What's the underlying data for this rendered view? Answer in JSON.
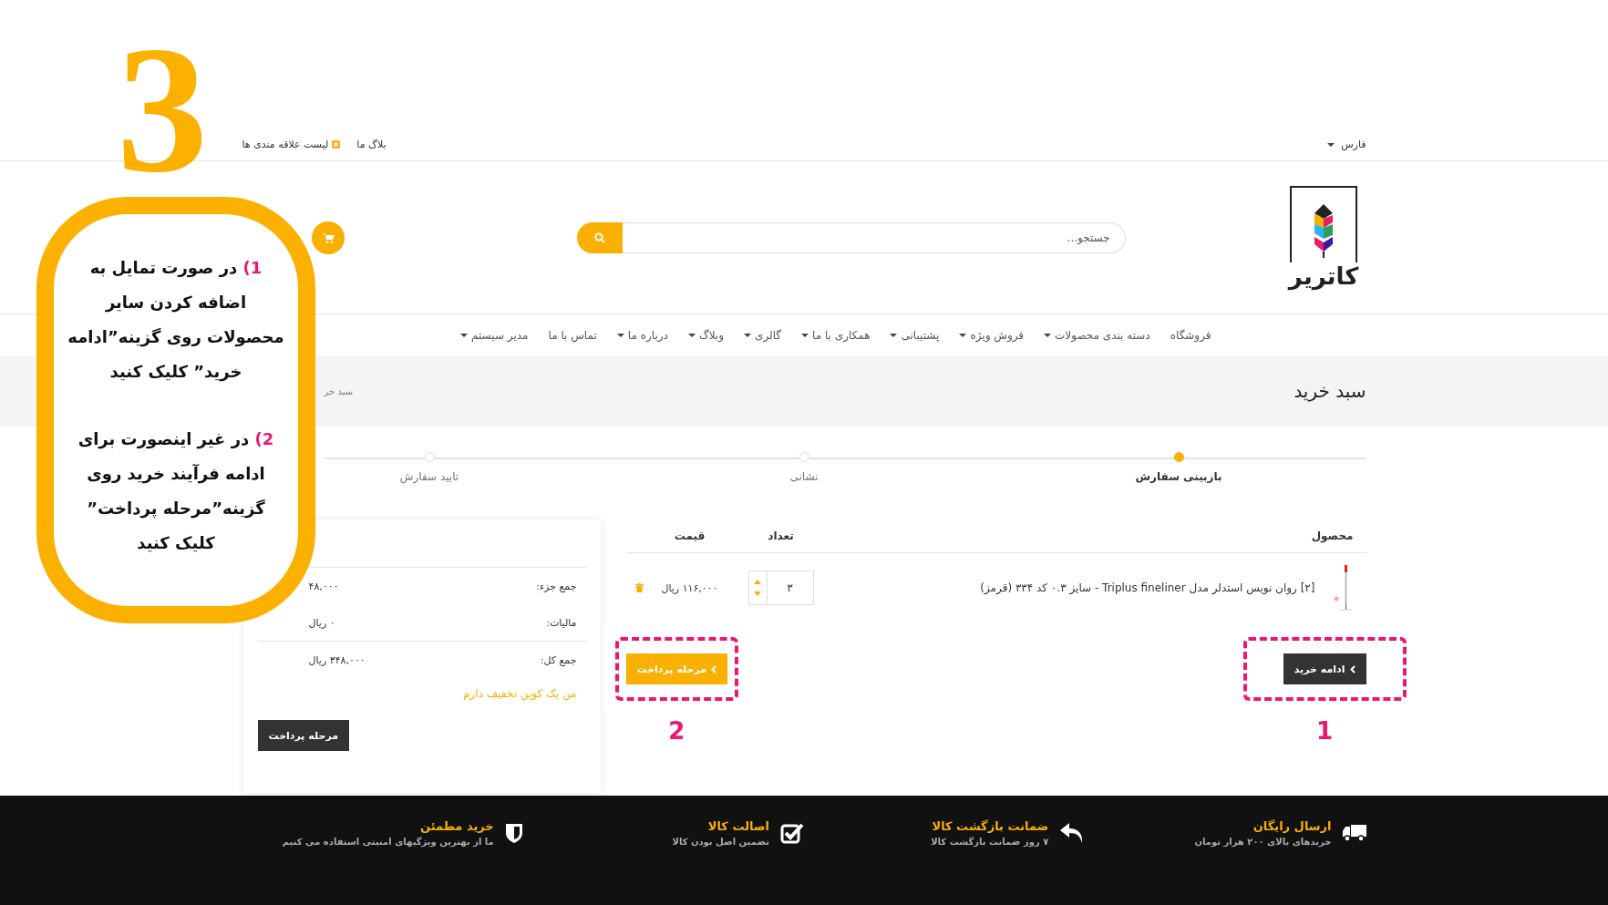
{
  "annotation": {
    "step_number": "3",
    "callout": [
      {
        "number": "1)",
        "text": "در صورت تمایل به اضافه کردن سایر محصولات روی گزینه”ادامه خرید” کلیک کنید"
      },
      {
        "number": "2)",
        "text": "در غیر اینصورت برای ادامه فرآیند خرید روی گزینه”مرحله پرداخت” کلیک کنید"
      }
    ],
    "highlights": [
      {
        "kind": "continue",
        "label": "1"
      },
      {
        "kind": "checkout",
        "label": "2"
      }
    ]
  },
  "top_bar": {
    "language": "فارس",
    "links": [
      {
        "label": "بلاگ ما",
        "kind": "link"
      },
      {
        "label": "لیست علاقه مندی ها",
        "kind": "wishlist"
      }
    ]
  },
  "header": {
    "logo_text": "کاتریر",
    "search": {
      "placeholder": "جستجو..."
    }
  },
  "nav": [
    {
      "label": "فروشگاه",
      "dropdown": false
    },
    {
      "label": "دسته بندی محصولات",
      "dropdown": true
    },
    {
      "label": "فروش ویژه",
      "dropdown": true
    },
    {
      "label": "پشتیبانی",
      "dropdown": true
    },
    {
      "label": "همکاری با ما",
      "dropdown": true
    },
    {
      "label": "گالری",
      "dropdown": true
    },
    {
      "label": "وبلاگ",
      "dropdown": true
    },
    {
      "label": "درباره ما",
      "dropdown": true
    },
    {
      "label": "تماس با ما",
      "dropdown": false
    },
    {
      "label": "مدیر سیستم",
      "dropdown": true
    }
  ],
  "page_title": "سبد خرید",
  "breadcrumb": "سبد خر",
  "steps": [
    {
      "label": "بازبینی سفارش",
      "selected": true
    },
    {
      "label": "نشانی",
      "selected": false
    },
    {
      "label": "تایید سفارش",
      "selected": false
    }
  ],
  "cart": {
    "columns": [
      "محصول",
      "تعداد",
      "قیمت"
    ],
    "rows": [
      {
        "product": "[۲] روان نویس استدلر مدل Triplus fineliner - سایز ۰.۳ کد ۳۳۴ (قرمز)",
        "quantity": "۳",
        "price": "۱۱۶,۰۰۰ ریال"
      }
    ],
    "continue_button": "ادامه خرید",
    "checkout_button": "مرحله پرداخت"
  },
  "summary": {
    "rows": [
      {
        "label": "جمع جزء:",
        "value": "۴۸,۰۰۰"
      },
      {
        "label": "مالیات:",
        "value": "۰ ریال"
      },
      {
        "label": "جمع کل:",
        "value": "۳۴۸,۰۰۰ ریال"
      }
    ],
    "coupon_link": "من یک کوپن تخفیف دارم",
    "checkout_button": "مرحله پرداخت"
  },
  "footer": [
    {
      "kind": "truck",
      "title": "ارسال رایگان",
      "subtitle": "خریدهای بالای ۲۰۰ هزار تومان"
    },
    {
      "kind": "return",
      "title": "ضمانت بازگشت کالا",
      "subtitle": "۷ روز ضمانت بازگشت کالا"
    },
    {
      "kind": "check",
      "title": "اصالت کالا",
      "subtitle": "تضمین اصل بودن کالا"
    },
    {
      "kind": "shield",
      "title": "خرید مطمئن",
      "subtitle": "ما از بهترین ویژگیهای امنیتی استفاده می کنیم"
    }
  ]
}
